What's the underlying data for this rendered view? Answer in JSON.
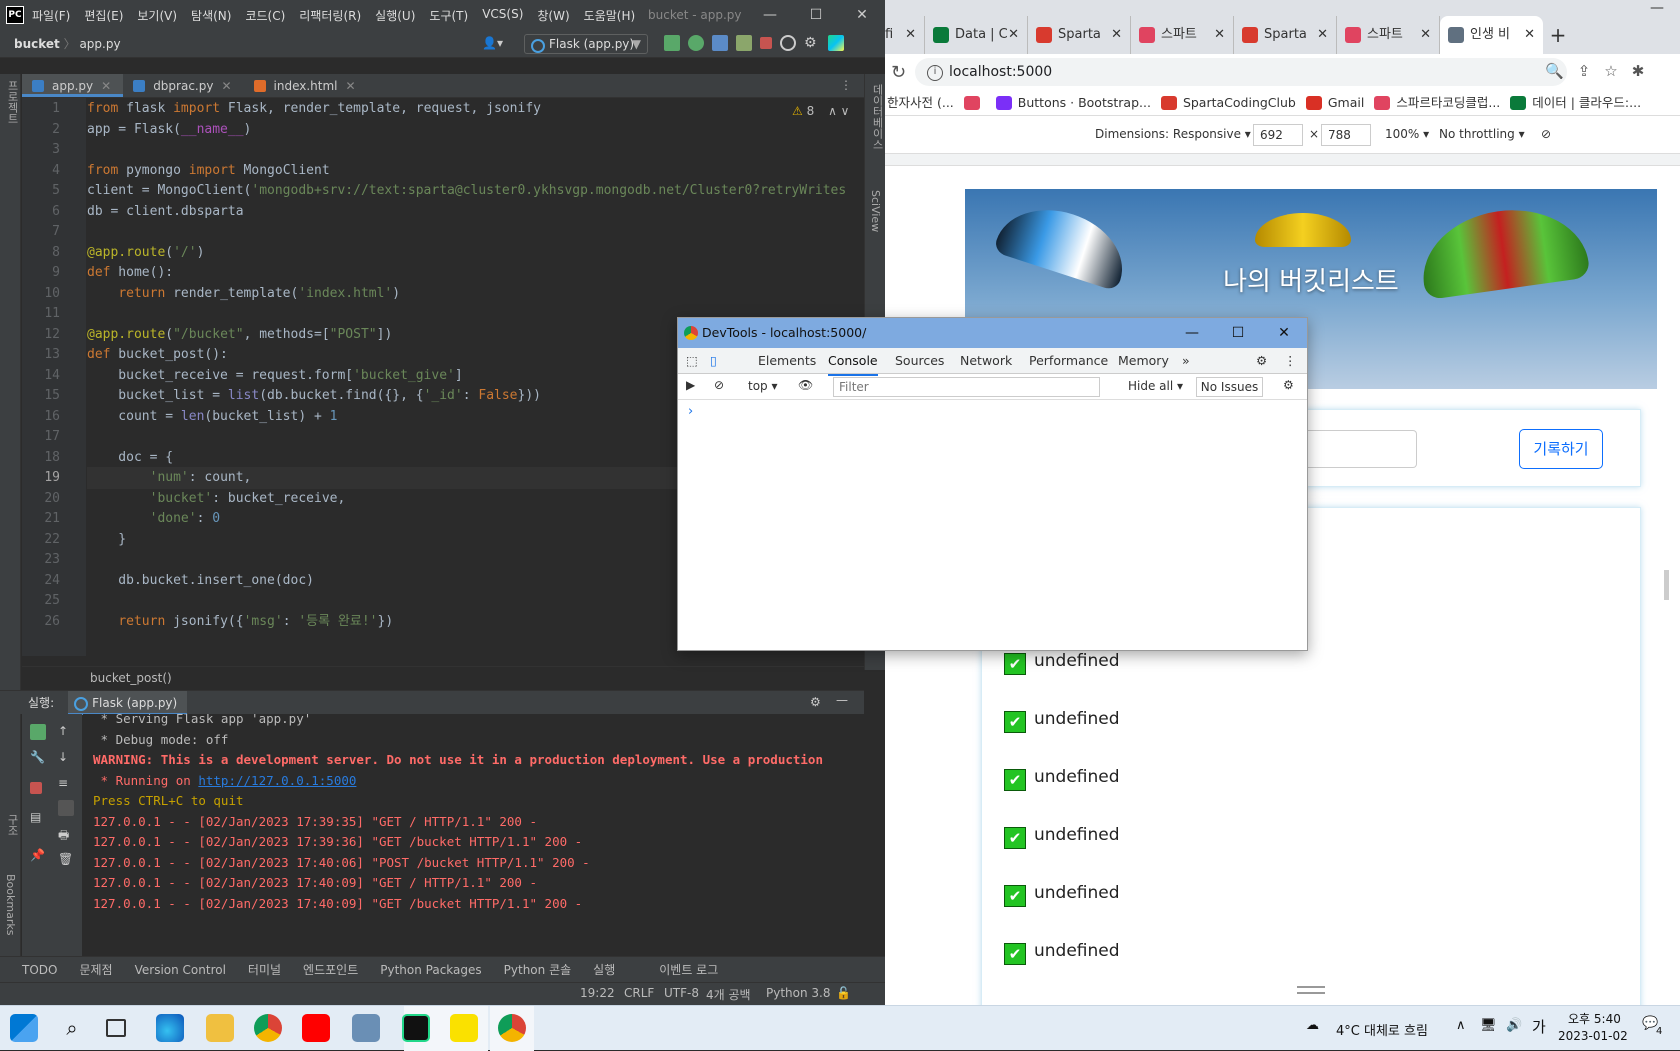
{
  "ide": {
    "menu": [
      "파일(F)",
      "편집(E)",
      "보기(V)",
      "탐색(N)",
      "코드(C)",
      "리팩터링(R)",
      "실행(U)",
      "도구(T)",
      "VCS(S)",
      "창(W)",
      "도움말(H)"
    ],
    "window_title": "bucket - app.py",
    "breadcrumb_project": "bucket",
    "breadcrumb_file": "app.py",
    "run_config": "Flask (app.py)",
    "tabs": [
      "app.py",
      "dbprac.py",
      "index.html"
    ],
    "warning_count": "8",
    "left_strip_labels": [
      "프로젝트",
      "구조",
      "Bookmarks"
    ],
    "right_strip_labels": [
      "데이터베이스",
      "SciView"
    ],
    "code_lines": [
      "from flask import Flask, render_template, request, jsonify",
      "app = Flask(__name__)",
      "",
      "from pymongo import MongoClient",
      "client = MongoClient('mongodb+srv://text:sparta@cluster0.ykhsvgp.mongodb.net/Cluster0?retryWrites",
      "db = client.dbsparta",
      "",
      "@app.route('/')",
      "def home():",
      "    return render_template('index.html')",
      "",
      "@app.route(\"/bucket\", methods=[\"POST\"])",
      "def bucket_post():",
      "    bucket_receive = request.form['bucket_give']",
      "    bucket_list = list(db.bucket.find({}, {'_id': False}))",
      "    count = len(bucket_list) + 1",
      "",
      "    doc = {",
      "        'num': count,",
      "        'bucket': bucket_receive,",
      "        'done': 0",
      "    }",
      "",
      "    db.bucket.insert_one(doc)",
      "",
      "    return jsonify({'msg': '등록 완료!'})"
    ],
    "line_numbers": [
      "1",
      "2",
      "3",
      "4",
      "5",
      "6",
      "7",
      "8",
      "9",
      "10",
      "11",
      "12",
      "13",
      "14",
      "15",
      "16",
      "17",
      "18",
      "19",
      "20",
      "21",
      "22",
      "23",
      "24",
      "25",
      "26"
    ],
    "editor_breadcrumb": "bucket_post()",
    "run_label": "실행:",
    "run_tab": "Flask (app.py)",
    "console_lines": [
      {
        "text": " * Serving Flask app 'app.py'",
        "cls": "c-gray"
      },
      {
        "text": " * Debug mode: off",
        "cls": "c-gray"
      },
      {
        "text": "WARNING: This is a development server. Do not use it in a production deployment. Use a production",
        "cls": "c-red"
      },
      {
        "text": " * Running on ",
        "cls": "c-red2",
        "link": "http://127.0.0.1:5000"
      },
      {
        "text": "Press CTRL+C to quit",
        "cls": "c-yel"
      },
      {
        "text": "127.0.0.1 - - [02/Jan/2023 17:39:35] \"GET / HTTP/1.1\" 200 -",
        "cls": "c-red2"
      },
      {
        "text": "127.0.0.1 - - [02/Jan/2023 17:39:36] \"GET /bucket HTTP/1.1\" 200 -",
        "cls": "c-red2"
      },
      {
        "text": "127.0.0.1 - - [02/Jan/2023 17:40:06] \"POST /bucket HTTP/1.1\" 200 -",
        "cls": "c-red2"
      },
      {
        "text": "127.0.0.1 - - [02/Jan/2023 17:40:09] \"GET / HTTP/1.1\" 200 -",
        "cls": "c-red2"
      },
      {
        "text": "127.0.0.1 - - [02/Jan/2023 17:40:09] \"GET /bucket HTTP/1.1\" 200 -",
        "cls": "c-red2"
      }
    ],
    "bottom_tools": [
      "TODO",
      "문제점",
      "Version Control",
      "터미널",
      "엔드포인트",
      "Python Packages",
      "Python 콘솔",
      "실행",
      "이벤트 로그"
    ],
    "status": {
      "position": "19:22",
      "line_sep": "CRLF",
      "encoding": "UTF-8",
      "indent": "4개 공백",
      "interpreter": "Python 3.8"
    }
  },
  "chrome": {
    "tabs": [
      {
        "label": "fi",
        "color": "#0a7a3a"
      },
      {
        "label": "Data | C",
        "color": "#0a7a3a"
      },
      {
        "label": "Sparta",
        "color": "#d83a2e"
      },
      {
        "label": "스파트",
        "color": "#e04460"
      },
      {
        "label": "Sparta",
        "color": "#d83a2e"
      },
      {
        "label": "스파트",
        "color": "#e04460"
      },
      {
        "label": "인생 비",
        "color": "#607080"
      }
    ],
    "new_tab": "+",
    "url": "localhost:5000",
    "bookmarks": [
      {
        "label": "한자사전 (...",
        "color": "#5f6368"
      },
      {
        "label": "",
        "color": "#e04460"
      },
      {
        "label": "Buttons · Bootstrap...",
        "color": "#7b2ff7"
      },
      {
        "label": "SpartaCodingClub",
        "color": "#d83a2e"
      },
      {
        "label": "Gmail",
        "color": "#d93025"
      },
      {
        "label": "스파르타코딩클럽...",
        "color": "#e04460"
      },
      {
        "label": "데이터 | 클라우드:...",
        "color": "#0a7a3a"
      }
    ],
    "dimensions_label": "Dimensions: Responsive",
    "width_value": "692",
    "height_value": "788",
    "zoom": "100%",
    "throttle": "No throttling",
    "page": {
      "title": "나의 버킷리스트",
      "record_button": "기록하기",
      "items": [
        "undefined",
        "undefined",
        "undefined",
        "undefined",
        "undefined",
        "undefined"
      ],
      "item_done": true
    }
  },
  "devtools": {
    "title": "DevTools - localhost:5000/",
    "tabs": [
      "Elements",
      "Console",
      "Sources",
      "Network",
      "Performance",
      "Memory"
    ],
    "active_tab": "Console",
    "context": "top",
    "filter_placeholder": "Filter",
    "levels": "Hide all",
    "issues": "No Issues",
    "prompt": "›"
  },
  "taskbar": {
    "weather": "4°C 대체로 흐림",
    "ime": "가",
    "time": "오후 5:40",
    "date": "2023-01-02",
    "notifications": "4"
  }
}
